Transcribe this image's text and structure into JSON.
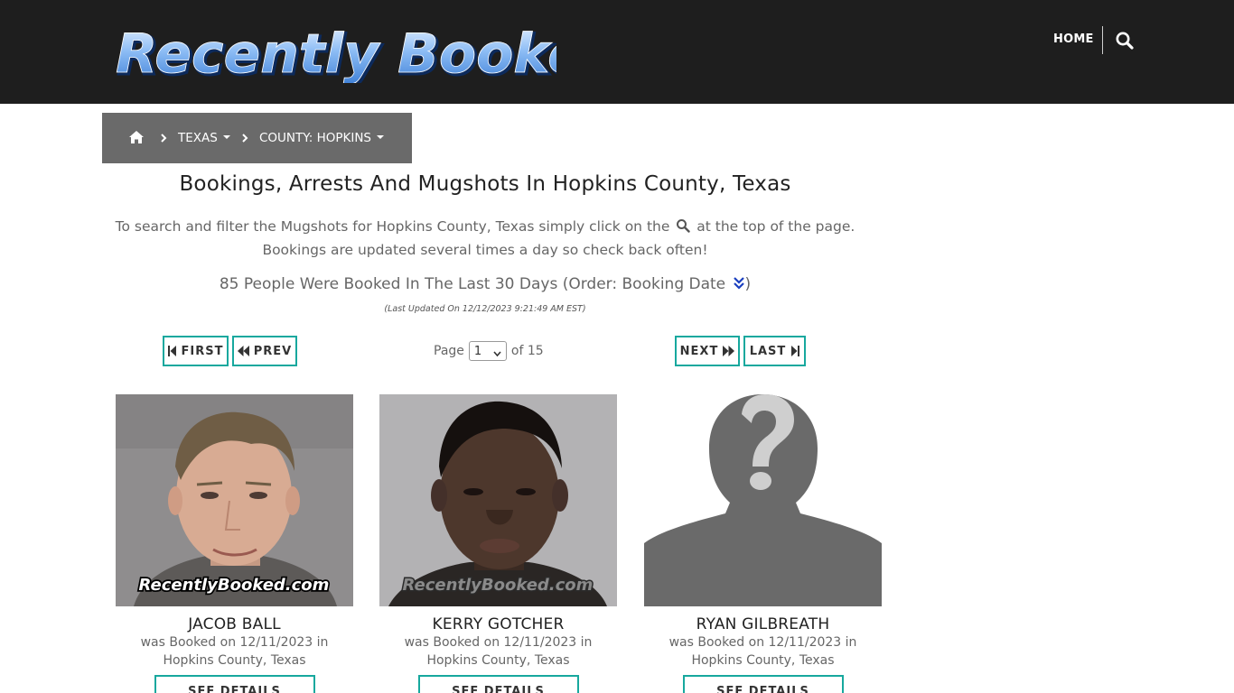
{
  "header": {
    "logo_text": "Recently Booked",
    "nav_home": "HOME",
    "search_icon": "search-icon"
  },
  "breadcrumb": {
    "home_icon": "home-icon",
    "items": [
      "TEXAS",
      "COUNTY: HOPKINS"
    ]
  },
  "page_title": "Bookings, Arrests And Mugshots In Hopkins County, Texas",
  "intro": {
    "line1_before": "To search and filter the Mugshots for Hopkins County, Texas simply click on the",
    "line1_after": "at the top of the page.",
    "line2": "Bookings are updated several times a day so check back often!"
  },
  "summary": {
    "count_text": "85 People Were Booked In The Last 30 Days (Order: Booking Date",
    "close_paren": ")",
    "last_updated": "(Last Updated On 12/12/2023 9:21:49 AM EST)"
  },
  "pagination": {
    "first": "FIRST",
    "prev": "PREV",
    "next": "NEXT",
    "last": "LAST",
    "page_label": "Page",
    "current_page": "1",
    "of_label": "of 15"
  },
  "watermark": "RecentlyBooked.com",
  "cards": [
    {
      "name": "JACOB BALL",
      "desc1": "was Booked on 12/11/2023 in",
      "desc2": "Hopkins County, Texas",
      "button": "SEE DETAILS"
    },
    {
      "name": "KERRY GOTCHER",
      "desc1": "was Booked on 12/11/2023 in",
      "desc2": "Hopkins County, Texas",
      "button": "SEE DETAILS"
    },
    {
      "name": "RYAN GILBREATH",
      "desc1": "was Booked on 12/11/2023 in",
      "desc2": "Hopkins County, Texas",
      "button": "SEE DETAILS"
    }
  ],
  "colors": {
    "header_bg": "#1e1e1e",
    "breadcrumb_bg": "#6a6a6a",
    "button_border": "#17a89e",
    "logo_blue": "#5b9ee8"
  }
}
